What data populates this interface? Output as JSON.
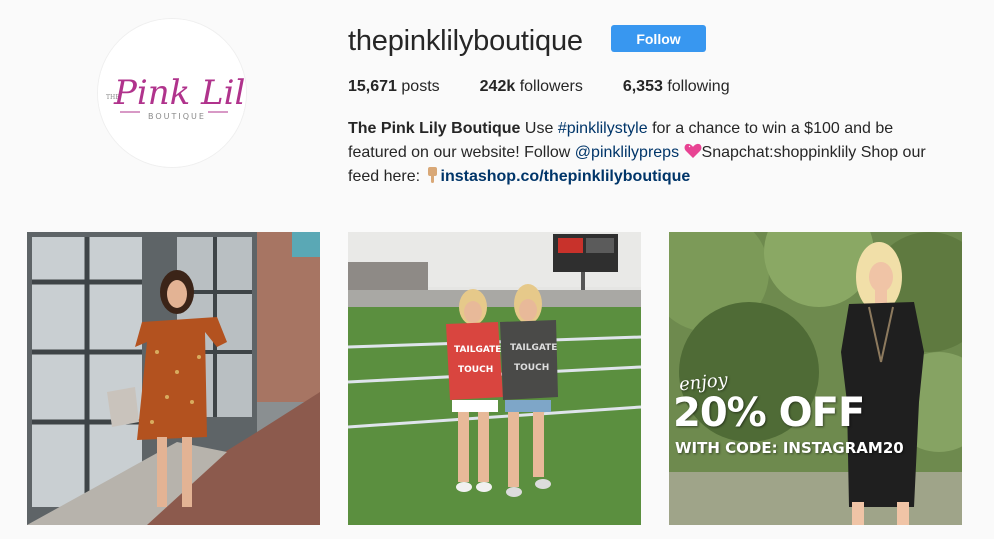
{
  "profile": {
    "username": "thepinklilyboutique",
    "follow_label": "Follow",
    "avatar": {
      "logo_prefix": "THE",
      "logo_main": "Pink Lily",
      "logo_sub": "BOUTIQUE"
    }
  },
  "stats": {
    "posts_count": "15,671",
    "posts_label": "posts",
    "followers_count": "242k",
    "followers_label": "followers",
    "following_count": "6,353",
    "following_label": "following"
  },
  "bio": {
    "name": "The Pink Lily Boutique",
    "text1": "Use",
    "hashtag": "#pinklilystyle",
    "text2": "for a chance to win a $100 and be featured on our website! Follow",
    "mention": "@pinklilypreps",
    "text3": "Snapchat:shoppinklily Shop our feed here:",
    "link": "instashop.co/thepinklilyboutique"
  },
  "posts": [
    {
      "subject": "woman in floral off-shoulder dress by window"
    },
    {
      "subject": "two women in football tailgate tees on field"
    },
    {
      "subject": "woman in black dress promo",
      "promo_enjoy": "enjoy",
      "promo_off": "20% OFF",
      "promo_code": "WITH CODE: INSTAGRAM20"
    }
  ],
  "icons": [
    "heart-emoji-icon",
    "pointing-down-hand-icon"
  ],
  "colors": {
    "accent": "#3897f0",
    "link": "#003569",
    "background": "#fafafa",
    "logo_pink": "#b0338c"
  }
}
